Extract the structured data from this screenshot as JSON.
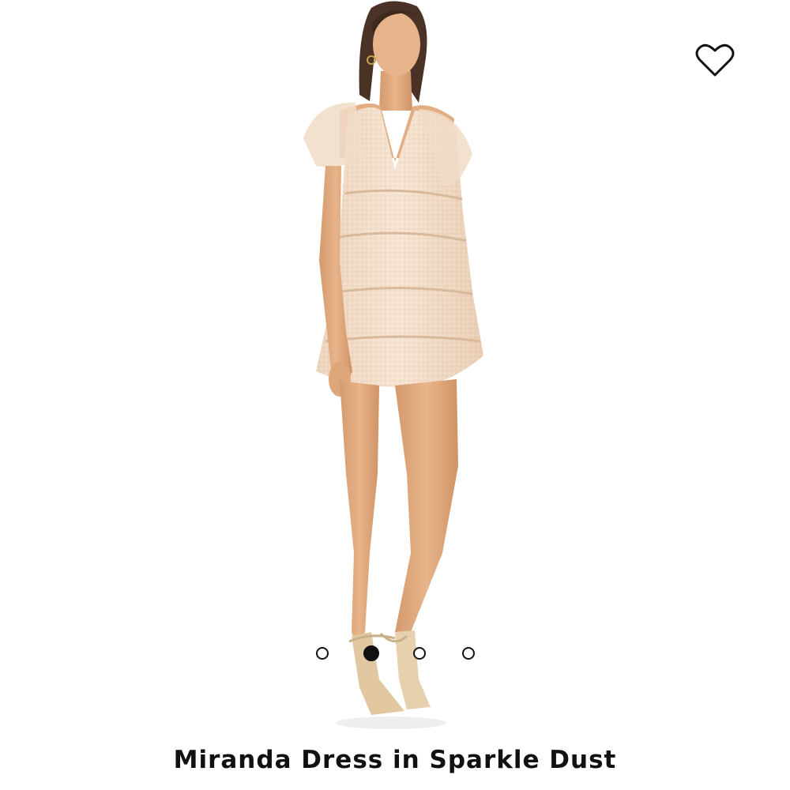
{
  "product": {
    "title": "Miranda Dress in Sparkle Dust",
    "image_icon": "model-wearing-dress"
  },
  "wishlist": {
    "icon": "heart-icon"
  },
  "carousel": {
    "dot_count": 4,
    "active_index": 1
  },
  "colors": {
    "accent": "#111111",
    "dress": "#f2dcc8",
    "skin": "#e2ad82"
  }
}
